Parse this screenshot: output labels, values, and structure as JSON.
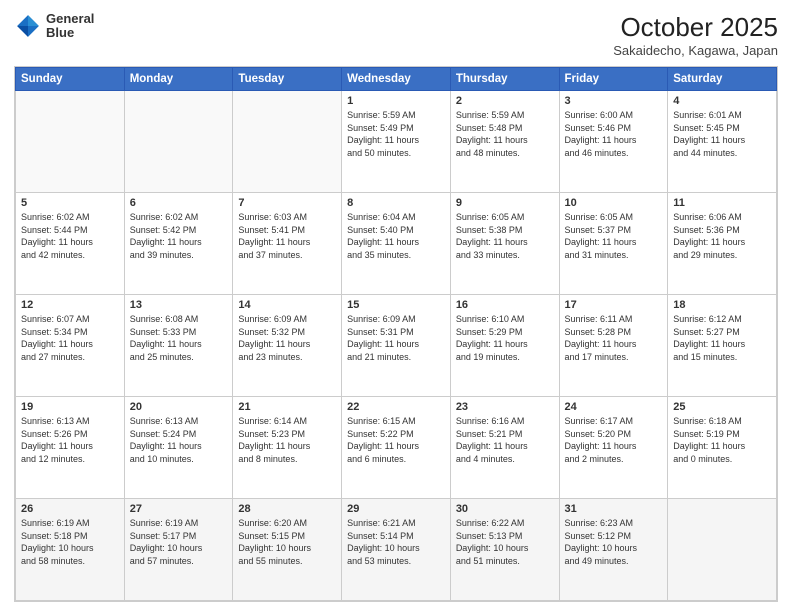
{
  "header": {
    "logo_line1": "General",
    "logo_line2": "Blue",
    "title": "October 2025",
    "subtitle": "Sakaidecho, Kagawa, Japan"
  },
  "days_of_week": [
    "Sunday",
    "Monday",
    "Tuesday",
    "Wednesday",
    "Thursday",
    "Friday",
    "Saturday"
  ],
  "weeks": [
    [
      {
        "day": "",
        "info": ""
      },
      {
        "day": "",
        "info": ""
      },
      {
        "day": "",
        "info": ""
      },
      {
        "day": "1",
        "info": "Sunrise: 5:59 AM\nSunset: 5:49 PM\nDaylight: 11 hours\nand 50 minutes."
      },
      {
        "day": "2",
        "info": "Sunrise: 5:59 AM\nSunset: 5:48 PM\nDaylight: 11 hours\nand 48 minutes."
      },
      {
        "day": "3",
        "info": "Sunrise: 6:00 AM\nSunset: 5:46 PM\nDaylight: 11 hours\nand 46 minutes."
      },
      {
        "day": "4",
        "info": "Sunrise: 6:01 AM\nSunset: 5:45 PM\nDaylight: 11 hours\nand 44 minutes."
      }
    ],
    [
      {
        "day": "5",
        "info": "Sunrise: 6:02 AM\nSunset: 5:44 PM\nDaylight: 11 hours\nand 42 minutes."
      },
      {
        "day": "6",
        "info": "Sunrise: 6:02 AM\nSunset: 5:42 PM\nDaylight: 11 hours\nand 39 minutes."
      },
      {
        "day": "7",
        "info": "Sunrise: 6:03 AM\nSunset: 5:41 PM\nDaylight: 11 hours\nand 37 minutes."
      },
      {
        "day": "8",
        "info": "Sunrise: 6:04 AM\nSunset: 5:40 PM\nDaylight: 11 hours\nand 35 minutes."
      },
      {
        "day": "9",
        "info": "Sunrise: 6:05 AM\nSunset: 5:38 PM\nDaylight: 11 hours\nand 33 minutes."
      },
      {
        "day": "10",
        "info": "Sunrise: 6:05 AM\nSunset: 5:37 PM\nDaylight: 11 hours\nand 31 minutes."
      },
      {
        "day": "11",
        "info": "Sunrise: 6:06 AM\nSunset: 5:36 PM\nDaylight: 11 hours\nand 29 minutes."
      }
    ],
    [
      {
        "day": "12",
        "info": "Sunrise: 6:07 AM\nSunset: 5:34 PM\nDaylight: 11 hours\nand 27 minutes."
      },
      {
        "day": "13",
        "info": "Sunrise: 6:08 AM\nSunset: 5:33 PM\nDaylight: 11 hours\nand 25 minutes."
      },
      {
        "day": "14",
        "info": "Sunrise: 6:09 AM\nSunset: 5:32 PM\nDaylight: 11 hours\nand 23 minutes."
      },
      {
        "day": "15",
        "info": "Sunrise: 6:09 AM\nSunset: 5:31 PM\nDaylight: 11 hours\nand 21 minutes."
      },
      {
        "day": "16",
        "info": "Sunrise: 6:10 AM\nSunset: 5:29 PM\nDaylight: 11 hours\nand 19 minutes."
      },
      {
        "day": "17",
        "info": "Sunrise: 6:11 AM\nSunset: 5:28 PM\nDaylight: 11 hours\nand 17 minutes."
      },
      {
        "day": "18",
        "info": "Sunrise: 6:12 AM\nSunset: 5:27 PM\nDaylight: 11 hours\nand 15 minutes."
      }
    ],
    [
      {
        "day": "19",
        "info": "Sunrise: 6:13 AM\nSunset: 5:26 PM\nDaylight: 11 hours\nand 12 minutes."
      },
      {
        "day": "20",
        "info": "Sunrise: 6:13 AM\nSunset: 5:24 PM\nDaylight: 11 hours\nand 10 minutes."
      },
      {
        "day": "21",
        "info": "Sunrise: 6:14 AM\nSunset: 5:23 PM\nDaylight: 11 hours\nand 8 minutes."
      },
      {
        "day": "22",
        "info": "Sunrise: 6:15 AM\nSunset: 5:22 PM\nDaylight: 11 hours\nand 6 minutes."
      },
      {
        "day": "23",
        "info": "Sunrise: 6:16 AM\nSunset: 5:21 PM\nDaylight: 11 hours\nand 4 minutes."
      },
      {
        "day": "24",
        "info": "Sunrise: 6:17 AM\nSunset: 5:20 PM\nDaylight: 11 hours\nand 2 minutes."
      },
      {
        "day": "25",
        "info": "Sunrise: 6:18 AM\nSunset: 5:19 PM\nDaylight: 11 hours\nand 0 minutes."
      }
    ],
    [
      {
        "day": "26",
        "info": "Sunrise: 6:19 AM\nSunset: 5:18 PM\nDaylight: 10 hours\nand 58 minutes."
      },
      {
        "day": "27",
        "info": "Sunrise: 6:19 AM\nSunset: 5:17 PM\nDaylight: 10 hours\nand 57 minutes."
      },
      {
        "day": "28",
        "info": "Sunrise: 6:20 AM\nSunset: 5:15 PM\nDaylight: 10 hours\nand 55 minutes."
      },
      {
        "day": "29",
        "info": "Sunrise: 6:21 AM\nSunset: 5:14 PM\nDaylight: 10 hours\nand 53 minutes."
      },
      {
        "day": "30",
        "info": "Sunrise: 6:22 AM\nSunset: 5:13 PM\nDaylight: 10 hours\nand 51 minutes."
      },
      {
        "day": "31",
        "info": "Sunrise: 6:23 AM\nSunset: 5:12 PM\nDaylight: 10 hours\nand 49 minutes."
      },
      {
        "day": "",
        "info": ""
      }
    ]
  ]
}
